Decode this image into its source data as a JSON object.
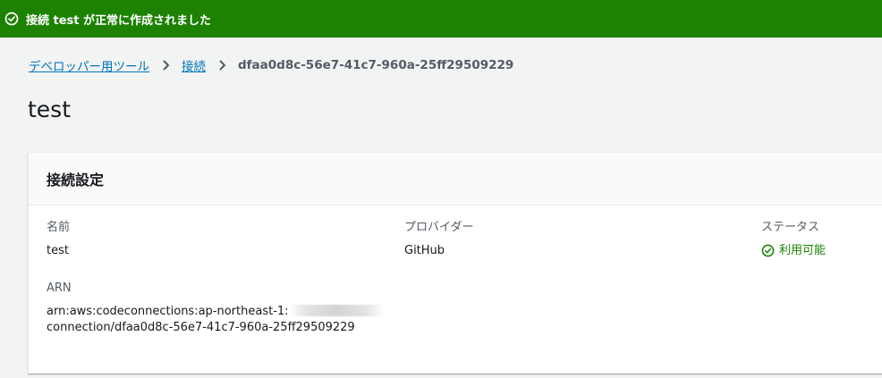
{
  "flash": {
    "message": "接続 test が正常に作成されました",
    "color": "#1d8102"
  },
  "breadcrumb": {
    "items": [
      "デベロッパー用ツール",
      "接続"
    ],
    "current": "dfaa0d8c-56e7-41c7-960a-25ff29509229"
  },
  "page": {
    "title": "test"
  },
  "panel": {
    "title": "接続設定",
    "name_label": "名前",
    "name_value": "test",
    "provider_label": "プロバイダー",
    "provider_value": "GitHub",
    "status_label": "ステータス",
    "status_value": "利用可能",
    "status_color": "#1d8102",
    "arn_label": "ARN",
    "arn_prefix": "arn:aws:codeconnections:ap-northeast-1:",
    "arn_suffix": "connection/dfaa0d8c-56e7-41c7-960a-25ff29509229"
  },
  "icons": {
    "flash": "check-circle-icon",
    "status": "check-circle-icon",
    "breadcrumb_separator": "chevron-right-icon"
  }
}
